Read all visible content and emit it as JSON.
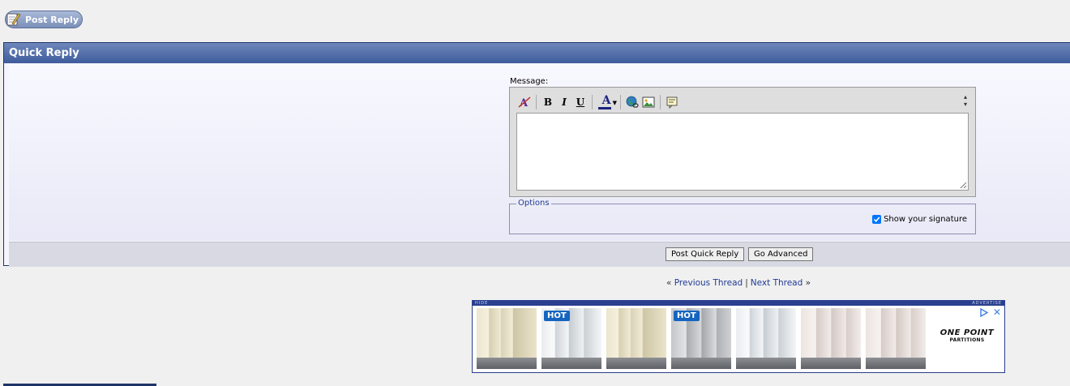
{
  "post_reply": {
    "label": "Post Reply",
    "icon": "pencil-paper-icon"
  },
  "quick_reply": {
    "title": "Quick Reply",
    "message_label": "Message:",
    "toolbar": {
      "items": [
        "remove-format-icon",
        "bold-icon",
        "italic-icon",
        "underline-icon",
        "font-color-icon",
        "insert-link-icon",
        "insert-image-icon",
        "insert-quote-icon"
      ],
      "bold": "B",
      "italic": "I",
      "underline": "U",
      "font_color": "A",
      "font_color_hex": "#1a237e"
    },
    "message_value": "",
    "options": {
      "legend": "Options",
      "signature_label": "Show your signature",
      "signature_checked": true
    },
    "buttons": {
      "post_quick_reply": "Post Quick Reply",
      "go_advanced": "Go Advanced"
    }
  },
  "thread_nav": {
    "prev_arrows": "«",
    "previous": "Previous Thread",
    "separator": "|",
    "next": "Next Thread",
    "next_arrows": "»"
  },
  "ad": {
    "hide_label": "HIDE",
    "advertise_label": "ADVERTISE",
    "tiles": [
      {
        "style": "warm",
        "badge": ""
      },
      {
        "style": "white",
        "badge": "HOT"
      },
      {
        "style": "warm",
        "badge": ""
      },
      {
        "style": "steel",
        "badge": "HOT"
      },
      {
        "style": "white",
        "badge": ""
      },
      {
        "style": "pink",
        "badge": ""
      },
      {
        "style": "pink",
        "badge": ""
      }
    ],
    "logo_line1": "ONE POINT",
    "logo_line2": "PARTITIONS",
    "close_glyph": "✕"
  },
  "colors": {
    "header_blue": "#3e5c9c",
    "link_blue": "#1f3a93",
    "panel_border": "#1e3569"
  }
}
